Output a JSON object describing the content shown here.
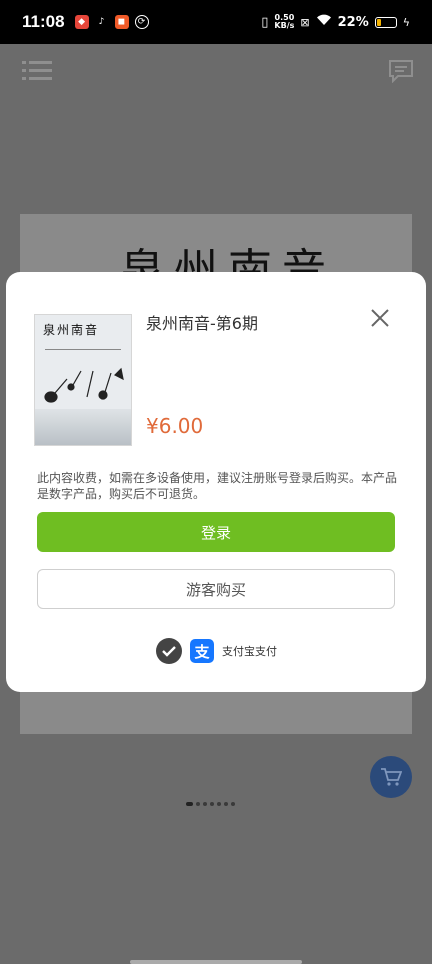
{
  "status_bar": {
    "time": "11:08",
    "net_speed_value": "0.50",
    "net_speed_unit": "KB/s",
    "battery": "22%",
    "app_icons": [
      {
        "name": "app-notification-icon",
        "color": "#e6463a"
      },
      {
        "name": "tiktok-icon",
        "color": "#111111"
      },
      {
        "name": "app-notification-icon-2",
        "color": "#f05a28"
      },
      {
        "name": "app-notification-icon-3",
        "color": "#ffffff"
      }
    ]
  },
  "background": {
    "page_title": "泉州南音",
    "accent_color": "#2b4a7a"
  },
  "modal": {
    "cover_title": "泉州南音",
    "product_title": "泉州南音-第6期",
    "price": "¥6.00",
    "notice": "此内容收费，如需在多设备使用，建议注册账号登录后购买。本产品是数字产品，购买后不可退货。",
    "login_label": "登录",
    "guest_label": "游客购买",
    "payment_label": "支付宝支付",
    "payment_icon_glyph": "支",
    "login_color": "#6fbe22",
    "price_color": "#e06a3a"
  }
}
